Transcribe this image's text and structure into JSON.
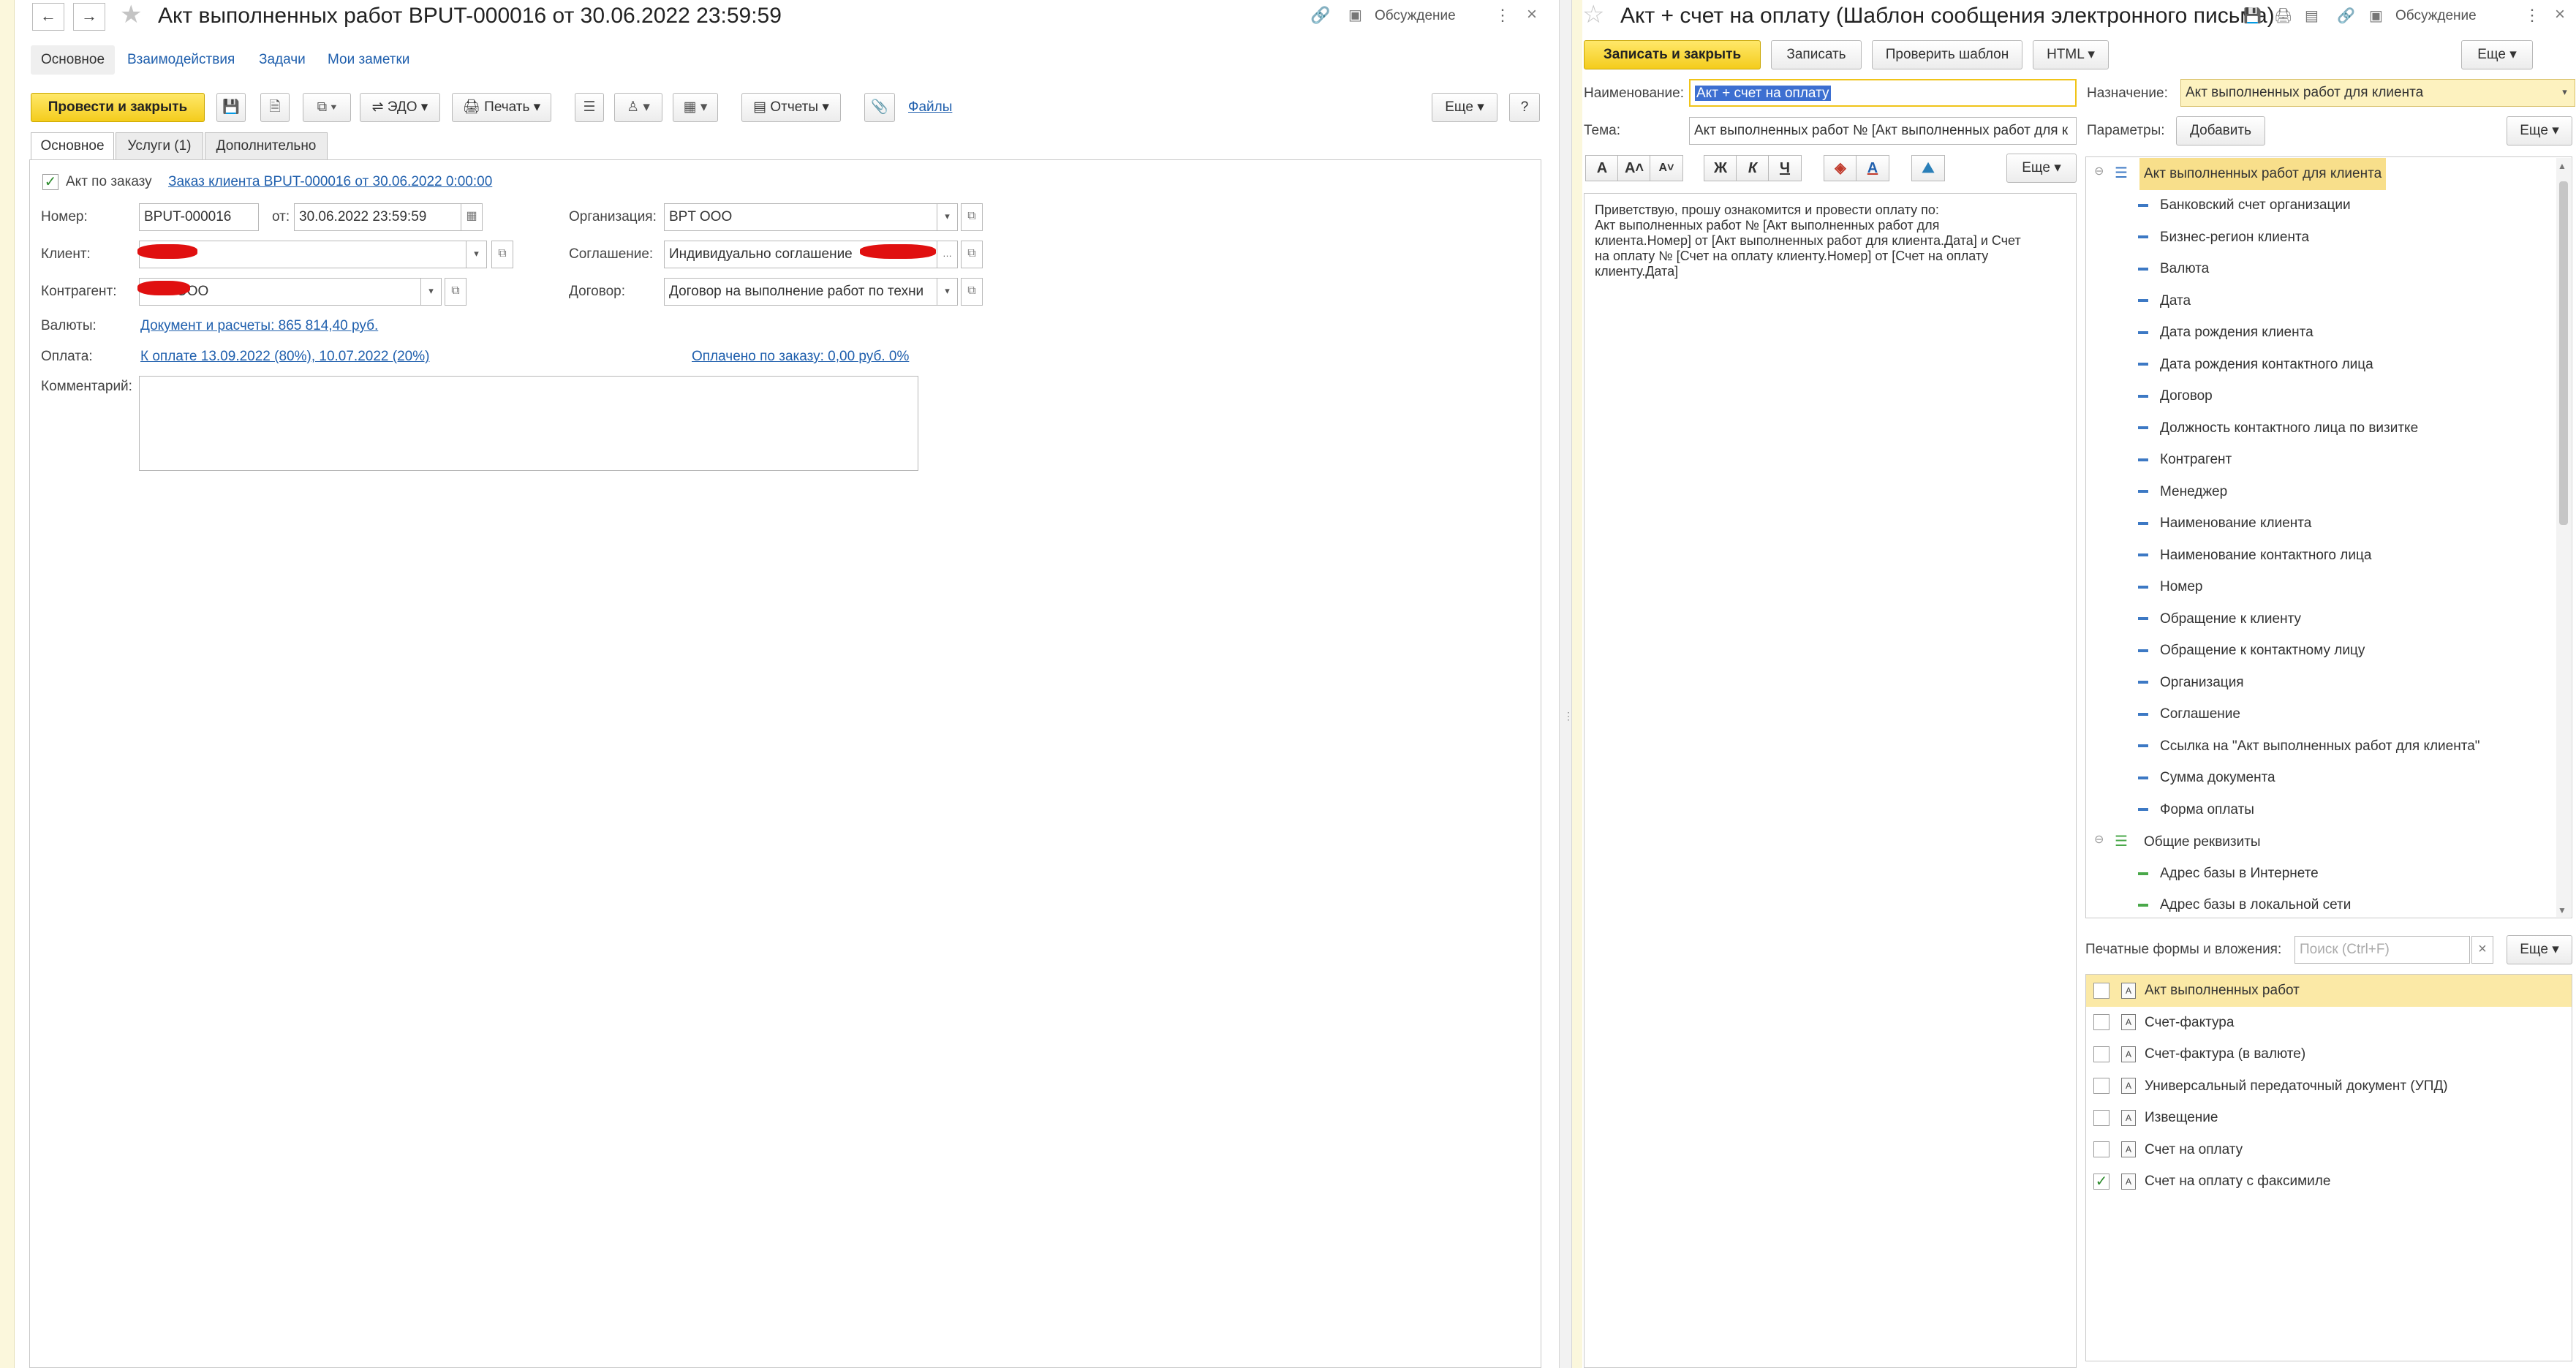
{
  "left": {
    "title": "Акт выполненных работ BPUT-000016 от 30.06.2022 23:59:59",
    "discuss": "Обсуждение",
    "top_tabs": [
      "Основное",
      "Взаимодействия",
      "Задачи",
      "Мои заметки"
    ],
    "toolbar": {
      "post_close": "Провести и закрыть",
      "edo": "ЭДО",
      "print": "Печать",
      "reports": "Отчеты",
      "files": "Файлы",
      "more": "Еще",
      "help": "?"
    },
    "subtabs": [
      "Основное",
      "Услуги (1)",
      "Дополнительно"
    ],
    "by_order_label": "Акт по заказу",
    "by_order_link": "Заказ клиента BPUT-000016 от 30.06.2022 0:00:00",
    "number_label": "Номер:",
    "number_value": "BPUT-000016",
    "date_label": "от:",
    "date_value": "30.06.2022 23:59:59",
    "client_label": "Клиент:",
    "contractor_label": "Контрагент:",
    "contractor_value": "ООО",
    "org_label": "Организация:",
    "org_value": "BPT ООО",
    "agreement_label": "Соглашение:",
    "agreement_value": "Индивидуально соглашение",
    "contract_label": "Договор:",
    "contract_value": "Договор на выполнение работ по  техни",
    "currency_label": "Валюты:",
    "currency_link": "Документ и расчеты: 865 814,40 руб.",
    "payment_label": "Оплата:",
    "payment_link": "К оплате 13.09.2022 (80%), 10.07.2022 (20%)",
    "paid_link": "Оплачено по заказу: 0,00 руб. 0%",
    "comment_label": "Комментарий:"
  },
  "right": {
    "title": "Акт + счет на оплату (Шаблон сообщения электронного письма)",
    "discuss": "Обсуждение",
    "toolbar": {
      "save_close": "Записать и закрыть",
      "save": "Записать",
      "check": "Проверить шаблон",
      "html": "HTML",
      "more": "Еще"
    },
    "name_label": "Наименование:",
    "name_value": "Акт + счет на оплату",
    "subject_label": "Тема:",
    "subject_value": "Акт выполненных работ № [Акт выполненных работ для к",
    "purpose_label": "Назначение:",
    "purpose_value": "Акт выполненных работ для клиента",
    "params_label": "Параметры:",
    "add_button": "Добавить",
    "params_more": "Еще",
    "format_buttons": [
      "A",
      "A˄",
      "A˅",
      "Ж",
      "К",
      "Ч"
    ],
    "format_more": "Еще",
    "body_lines": [
      "Приветствую, прошу ознакомится и провести оплату по:",
      "Акт выполненных работ № [Акт выполненных работ для",
      "клиента.Номер]  от [Акт выполненных работ для клиента.Дата]  и Счет",
      "на оплату № [Счет на оплату клиенту.Номер] от [Счет на оплату",
      "клиенту.Дата]"
    ],
    "tree_root": "Акт выполненных работ для клиента",
    "tree_items": [
      "Банковский счет организации",
      "Бизнес-регион клиента",
      "Валюта",
      "Дата",
      "Дата рождения клиента",
      "Дата рождения контактного лица",
      "Договор",
      "Должность контактного лица по визитке",
      "Контрагент",
      "Менеджер",
      "Наименование клиента",
      "Наименование контактного лица",
      "Номер",
      "Обращение к клиенту",
      "Обращение к контактному лицу",
      "Организация",
      "Соглашение",
      "Ссылка на \"Акт выполненных работ для клиента\"",
      "Сумма документа",
      "Форма оплаты"
    ],
    "tree_group2": "Общие реквизиты",
    "tree_group2_items": [
      "Адрес базы в Интернете",
      "Адрес базы в локальной сети"
    ],
    "print_label": "Печатные формы и вложения:",
    "search_placeholder": "Поиск (Ctrl+F)",
    "print_more": "Еще",
    "print_items": [
      {
        "label": "Акт выполненных работ",
        "checked": false
      },
      {
        "label": "Счет-фактура",
        "checked": false
      },
      {
        "label": "Счет-фактура (в валюте)",
        "checked": false
      },
      {
        "label": "Универсальный передаточный документ (УПД)",
        "checked": false
      },
      {
        "label": "Извещение",
        "checked": false
      },
      {
        "label": "Счет на оплату",
        "checked": false
      },
      {
        "label": "Счет на оплату с факсимиле",
        "checked": true
      }
    ]
  },
  "colors": {
    "accent_yellow": "#f4cc1c",
    "link_blue": "#1f5fad",
    "selection_yellow": "#f8df8b"
  }
}
